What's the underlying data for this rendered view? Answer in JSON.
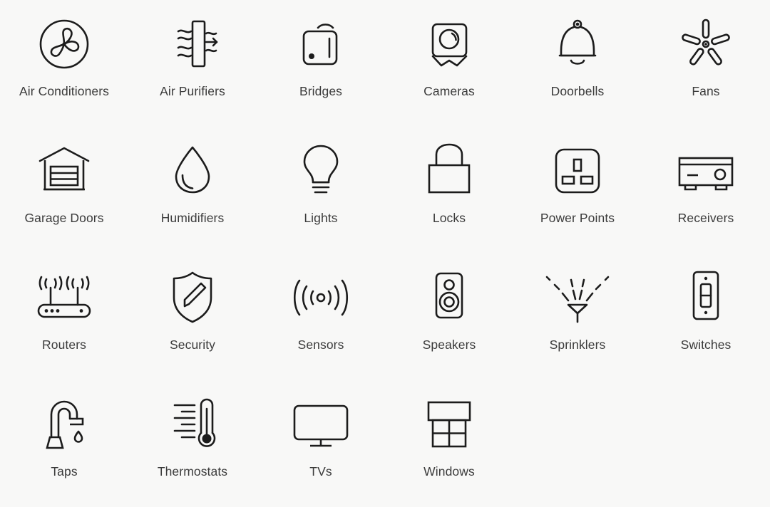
{
  "page": {
    "background_color": "#f8f8f7",
    "icon_stroke_color": "#1c1c1c",
    "label_color": "#3b3b3b",
    "columns": 6,
    "rows": 4,
    "total_items": 22
  },
  "grid": {
    "items": [
      {
        "label": "Air Conditioners",
        "icon": "air-conditioner-fan-icon"
      },
      {
        "label": "Air Purifiers",
        "icon": "air-purifier-icon"
      },
      {
        "label": "Bridges",
        "icon": "bridge-hub-icon"
      },
      {
        "label": "Cameras",
        "icon": "camera-icon"
      },
      {
        "label": "Doorbells",
        "icon": "doorbell-bell-icon"
      },
      {
        "label": "Fans",
        "icon": "ceiling-fan-icon"
      },
      {
        "label": "Garage Doors",
        "icon": "garage-door-icon"
      },
      {
        "label": "Humidifiers",
        "icon": "water-droplet-icon"
      },
      {
        "label": "Lights",
        "icon": "light-bulb-icon"
      },
      {
        "label": "Locks",
        "icon": "padlock-icon"
      },
      {
        "label": "Power Points",
        "icon": "power-socket-icon"
      },
      {
        "label": "Receivers",
        "icon": "av-receiver-icon"
      },
      {
        "label": "Routers",
        "icon": "router-icon"
      },
      {
        "label": "Security",
        "icon": "shield-icon"
      },
      {
        "label": "Sensors",
        "icon": "sensor-waves-icon"
      },
      {
        "label": "Speakers",
        "icon": "speaker-icon"
      },
      {
        "label": "Sprinklers",
        "icon": "sprinkler-icon"
      },
      {
        "label": "Switches",
        "icon": "light-switch-icon"
      },
      {
        "label": "Taps",
        "icon": "tap-faucet-icon"
      },
      {
        "label": "Thermostats",
        "icon": "thermometer-icon"
      },
      {
        "label": "TVs",
        "icon": "television-icon"
      },
      {
        "label": "Windows",
        "icon": "window-icon"
      }
    ]
  }
}
